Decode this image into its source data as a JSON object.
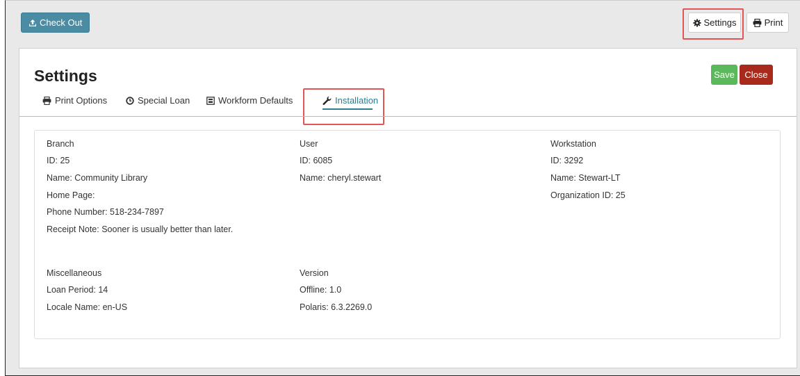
{
  "toolbar": {
    "checkout_label": "Check Out",
    "settings_label": "Settings",
    "print_label": "Print"
  },
  "page": {
    "title": "Settings",
    "save_label": "Save",
    "close_label": "Close"
  },
  "tabs": [
    {
      "label": "Print Options",
      "icon": "printer-icon",
      "active": false
    },
    {
      "label": "Special Loan",
      "icon": "clock-icon",
      "active": false
    },
    {
      "label": "Workform Defaults",
      "icon": "form-icon",
      "active": false
    },
    {
      "label": "Installation",
      "icon": "wrench-icon",
      "active": true
    }
  ],
  "branch": {
    "heading": "Branch",
    "id": "ID: 25",
    "name": "Name: Community Library",
    "home_page": "Home Page:",
    "phone": "Phone Number: 518-234-7897",
    "receipt_note": "Receipt Note: Sooner is usually better than later."
  },
  "user": {
    "heading": "User",
    "id": "ID: 6085",
    "name": "Name: cheryl.stewart"
  },
  "workstation": {
    "heading": "Workstation",
    "id": "ID: 3292",
    "name": "Name: Stewart-LT",
    "org_id": "Organization ID: 25"
  },
  "misc": {
    "heading": "Miscellaneous",
    "loan_period": "Loan Period: 14",
    "locale": "Locale Name: en-US"
  },
  "version": {
    "heading": "Version",
    "offline": "Offline: 1.0",
    "polaris": "Polaris: 6.3.2269.0"
  },
  "colors": {
    "checkout_bg": "#4a8ca3",
    "save_bg": "#5cb85c",
    "close_bg": "#a82a1c",
    "active_tab": "#2f7c8c",
    "highlight": "#e05555"
  }
}
